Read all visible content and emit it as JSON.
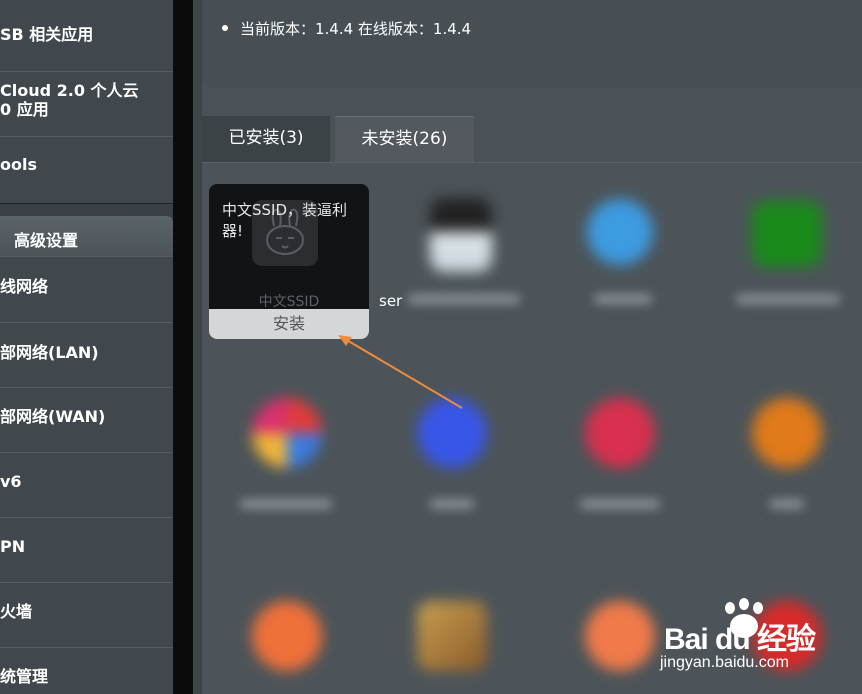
{
  "sidebar": {
    "top_items": [
      {
        "label": "SB 相关应用"
      },
      {
        "label": "Cloud 2.0 个人云\n0 应用"
      },
      {
        "label": "ools"
      }
    ],
    "advanced_header": "高级设置",
    "advanced_items": [
      {
        "label": "线网络"
      },
      {
        "label": "部网络(LAN)"
      },
      {
        "label": "部网络(WAN)"
      },
      {
        "label": "v6"
      },
      {
        "label": "PN"
      },
      {
        "label": "火墙"
      },
      {
        "label": "统管理"
      }
    ]
  },
  "version": {
    "text": "当前版本：1.4.4 在线版本：1.4.4"
  },
  "tabs": [
    {
      "label": "已安装(3)"
    },
    {
      "label": "未安装(26)"
    }
  ],
  "card": {
    "description": "中文SSID，装逼利器!",
    "name": "中文SSID",
    "install_label": "安装"
  },
  "partial_label": "ser",
  "watermark": {
    "brand": "Bai du 经验",
    "url": "jingyan.baidu.com"
  },
  "colors": {
    "arrow": "#f08a3c",
    "sidebar_bg": "#41484d",
    "main_bg": "#4c5459"
  }
}
